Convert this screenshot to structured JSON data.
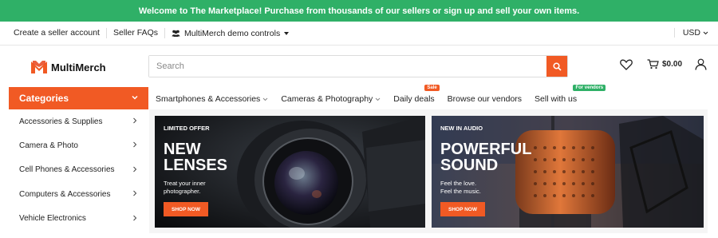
{
  "announcement": "Welcome to The Marketplace! Purchase from thousands of our sellers or sign up and sell your own items.",
  "topbar": {
    "create_seller": "Create a seller account",
    "seller_faqs": "Seller FAQs",
    "demo_controls": "MultiMerch demo controls",
    "currency": "USD"
  },
  "logo": {
    "text": "MultiMerch"
  },
  "search": {
    "placeholder": "Search"
  },
  "cart": {
    "total": "$0.00"
  },
  "categories": {
    "title": "Categories",
    "items": [
      {
        "label": "Accessories & Supplies"
      },
      {
        "label": "Camera & Photo"
      },
      {
        "label": "Cell Phones & Accessories"
      },
      {
        "label": "Computers & Accessories"
      },
      {
        "label": "Vehicle Electronics"
      }
    ]
  },
  "nav": {
    "items": [
      {
        "label": "Smartphones & Accessories"
      },
      {
        "label": "Cameras & Photography"
      },
      {
        "label": "Daily deals",
        "badge": "Sale"
      },
      {
        "label": "Browse our vendors"
      },
      {
        "label": "Sell with us",
        "badge": "For vendors"
      }
    ]
  },
  "banners": [
    {
      "tag": "LIMITED OFFER",
      "title_line1": "NEW",
      "title_line2": "LENSES",
      "sub_line1": "Treat your inner",
      "sub_line2": "photographer.",
      "button": "SHOP NOW"
    },
    {
      "tag": "NEW IN AUDIO",
      "title_line1": "POWERFUL",
      "title_line2": "SOUND",
      "sub_line1": "Feel the love.",
      "sub_line2": "Feel the music.",
      "button": "SHOP NOW"
    }
  ],
  "colors": {
    "accent": "#f15a24",
    "announcement_bg": "#2fb067",
    "sale_badge": "#f15a24",
    "vendor_badge": "#2fb067"
  },
  "icons": [
    "users-icon",
    "chevron-down-icon",
    "search-icon",
    "heart-icon",
    "cart-icon",
    "user-icon",
    "chevron-right-icon"
  ]
}
